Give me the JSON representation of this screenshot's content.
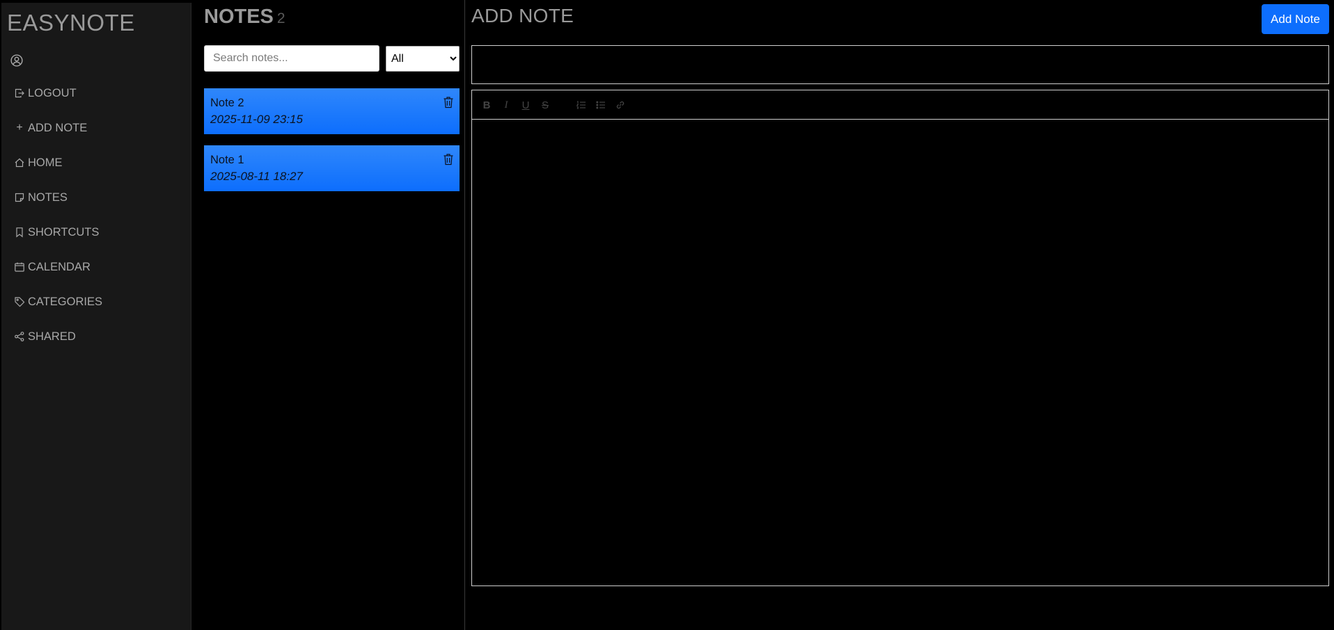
{
  "app": {
    "brand": "EASYNOTE"
  },
  "sidebar": {
    "items": [
      {
        "label": "LOGOUT",
        "icon": "logout-icon"
      },
      {
        "label": "ADD NOTE",
        "icon": "plus-icon"
      },
      {
        "label": "HOME",
        "icon": "home-icon"
      },
      {
        "label": "NOTES",
        "icon": "sticky-note-icon"
      },
      {
        "label": "SHORTCUTS",
        "icon": "bookmark-icon"
      },
      {
        "label": "CALENDAR",
        "icon": "calendar-icon"
      },
      {
        "label": "CATEGORIES",
        "icon": "tag-icon"
      },
      {
        "label": "SHARED",
        "icon": "share-icon"
      }
    ]
  },
  "notes": {
    "title": "NOTES",
    "count": "2",
    "search_placeholder": "Search notes...",
    "filter": {
      "selected": "All"
    },
    "list": [
      {
        "title": "Note 2",
        "date": "2025-11-09 23:15"
      },
      {
        "title": "Note 1",
        "date": "2025-08-11 18:27"
      }
    ]
  },
  "editor": {
    "heading": "ADD NOTE",
    "submit_label": "Add Note",
    "title_value": "",
    "toolbar": {
      "bold": "B",
      "italic": "I",
      "underline": "U",
      "strike": "S"
    }
  },
  "colors": {
    "accent": "#0d6efd",
    "sidebar_bg": "#181818",
    "page_bg": "#000000"
  }
}
